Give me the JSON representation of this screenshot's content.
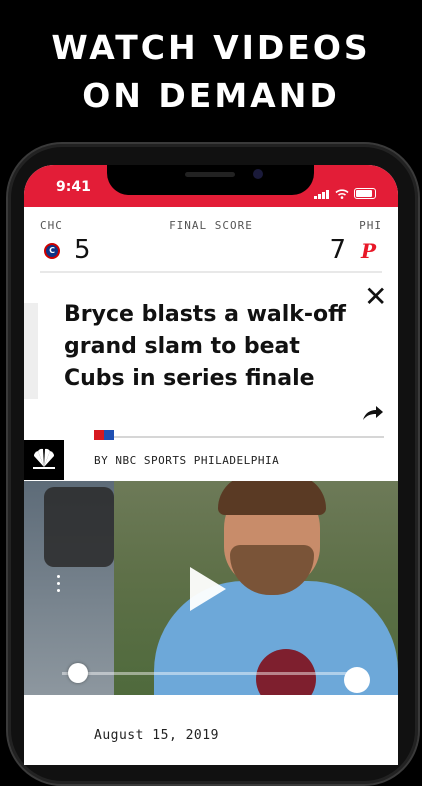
{
  "promo": {
    "line1": "WATCH VIDEOS",
    "line2": "ON DEMAND"
  },
  "status_bar": {
    "time": "9:41"
  },
  "score": {
    "away_abbr": "CHC",
    "home_abbr": "PHI",
    "label": "FINAL SCORE",
    "away_score": "5",
    "home_score": "7",
    "away_logo_text": "C",
    "home_logo_text": "P"
  },
  "article": {
    "title": "Bryce blasts a walk-off grand slam to beat Cubs in series finale",
    "byline": "BY NBC SPORTS PHILADELPHIA",
    "date": "August 15, 2019",
    "close_label": "✕"
  },
  "video": {
    "progress_fraction": 0.0
  },
  "colors": {
    "brand_red": "#e31d37",
    "phillies_red": "#e81828",
    "cubs_blue": "#0e3386"
  }
}
